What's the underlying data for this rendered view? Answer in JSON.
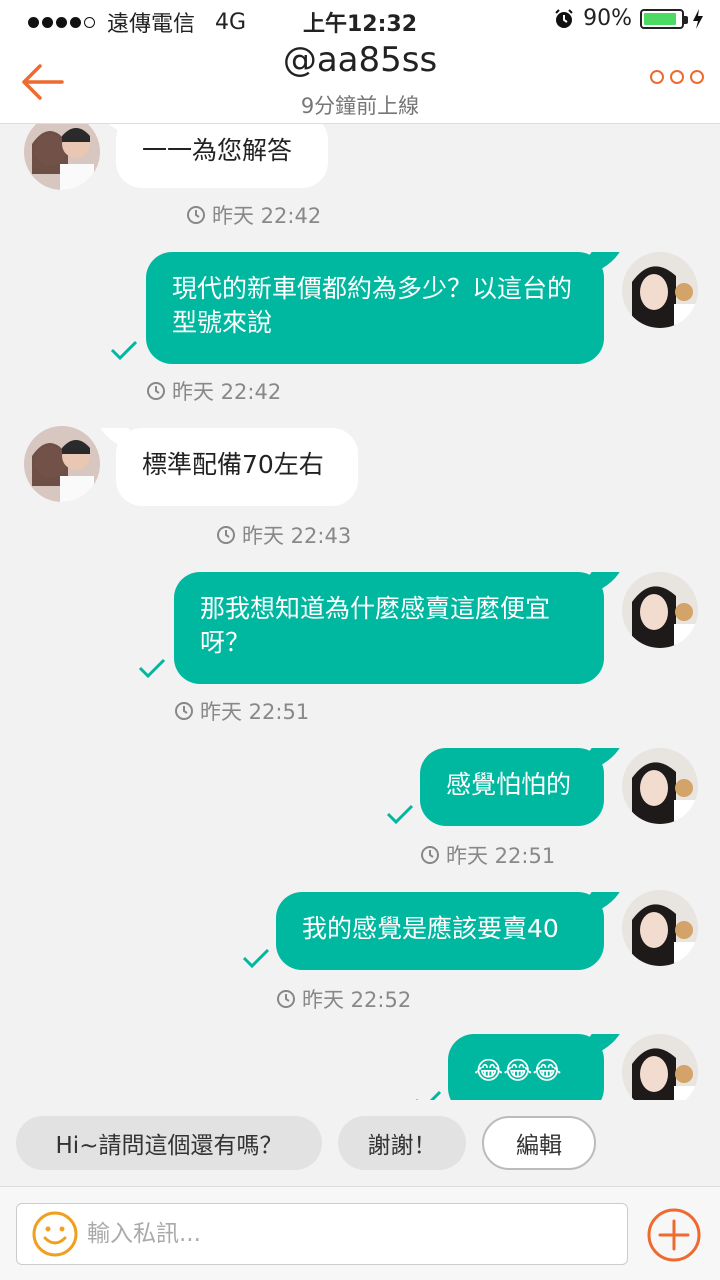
{
  "status": {
    "carrier": "遠傳電信",
    "network": "4G",
    "time": "上午12:32",
    "battery": "90%",
    "battery_level": 0.9
  },
  "header": {
    "title": "@aa85ss",
    "subtitle": "9分鐘前上線"
  },
  "messages": [
    {
      "text": "一一為您解答",
      "time": "昨天 22:42"
    },
    {
      "text": "現代的新車價都約為多少？以這台的型號來說",
      "time": "昨天 22:42"
    },
    {
      "text": "標準配備70左右",
      "time": "昨天 22:43"
    },
    {
      "text": "那我想知道為什麼感賣這麼便宜呀？",
      "time": "昨天 22:51"
    },
    {
      "text": "感覺怕怕的",
      "time": "昨天 22:51"
    },
    {
      "text": "我的感覺是應該要賣40",
      "time": "昨天 22:52"
    },
    {
      "text": "😂😂😂"
    }
  ],
  "quick_replies": [
    "Hi~請問這個還有嗎？",
    "謝謝！",
    "編輯"
  ],
  "input": {
    "placeholder": "輸入私訊..."
  },
  "colors": {
    "accent": "#ee6a2f",
    "outgoing": "#00b8a0",
    "incoming": "#ffffff"
  }
}
